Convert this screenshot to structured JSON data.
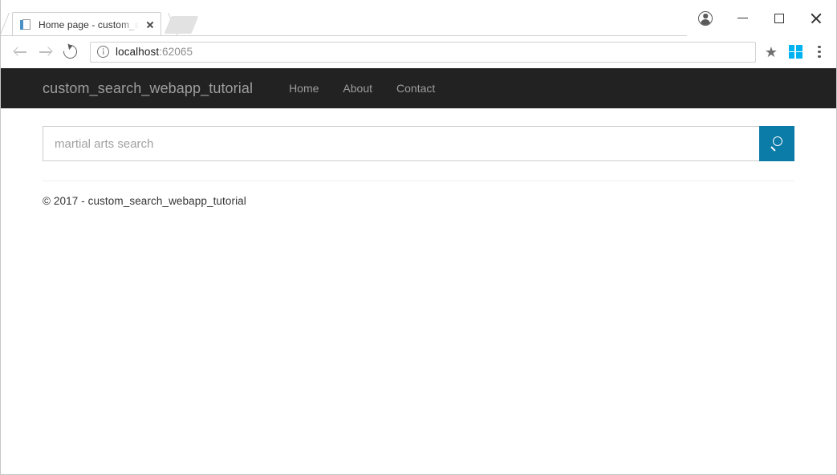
{
  "browser": {
    "tab": {
      "title": "Home page - custom_sea",
      "favicon_name": "page-favicon",
      "close_label": "Close tab"
    },
    "new_tab_label": "New tab",
    "window_controls": {
      "profile_label": "Profile",
      "minimize_label": "Minimize",
      "maximize_label": "Maximize",
      "close_label": "Close"
    },
    "toolbar": {
      "back_label": "Back",
      "forward_label": "Forward",
      "reload_label": "Reload",
      "url_host": "localhost",
      "url_port": ":62065",
      "bookmark_icon": "★",
      "extension_name": "windows-logo-extension",
      "menu_label": "Customize and control"
    }
  },
  "page": {
    "navbar": {
      "brand": "custom_search_webapp_tutorial",
      "links": [
        {
          "label": "Home"
        },
        {
          "label": "About"
        },
        {
          "label": "Contact"
        }
      ]
    },
    "search": {
      "value": "",
      "placeholder": "martial arts search",
      "button_icon": "search-icon",
      "button_color": "#0b7ba8"
    },
    "footer": {
      "text": "© 2017 - custom_search_webapp_tutorial"
    }
  }
}
